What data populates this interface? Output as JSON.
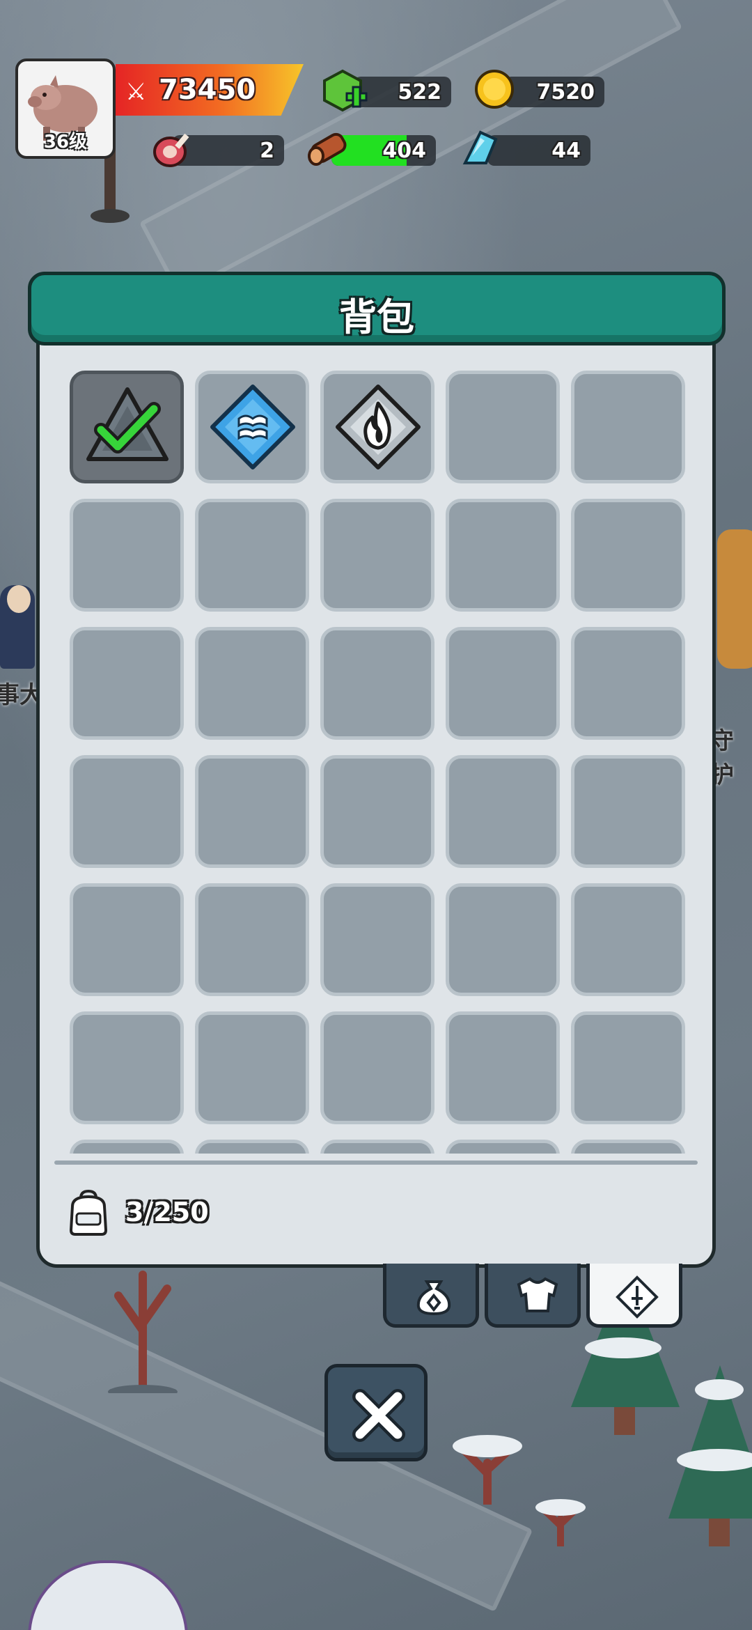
{
  "player": {
    "level_label": "36级",
    "power": "73450"
  },
  "resources": {
    "gems": "522",
    "gold": "7520",
    "meat": "2",
    "wood": "404",
    "wood_fill_pct": 72,
    "crystal": "44"
  },
  "npc_labels": {
    "left": "事大",
    "right": "守护"
  },
  "backpack": {
    "title": "背包",
    "capacity": "3/250",
    "items": [
      {
        "name": "shard-item",
        "icon": "stone-triangle-icon",
        "selected": true
      },
      {
        "name": "frost-item",
        "icon": "ice-crystal-icon",
        "selected": false
      },
      {
        "name": "fire-item",
        "icon": "flame-icon",
        "selected": false
      }
    ]
  },
  "tabs": [
    {
      "name": "tab-bag",
      "icon": "money-bag-icon",
      "active": false
    },
    {
      "name": "tab-armor",
      "icon": "armor-icon",
      "active": false
    },
    {
      "name": "tab-weapon",
      "icon": "sword-diamond-icon",
      "active": true
    }
  ],
  "colors": {
    "header": "#1d8e7f",
    "panel": "#dfe4e8",
    "slot": "#939fa8",
    "power_start": "#e52525",
    "power_end": "#f7c52a",
    "wood_bar": "#22e021"
  }
}
